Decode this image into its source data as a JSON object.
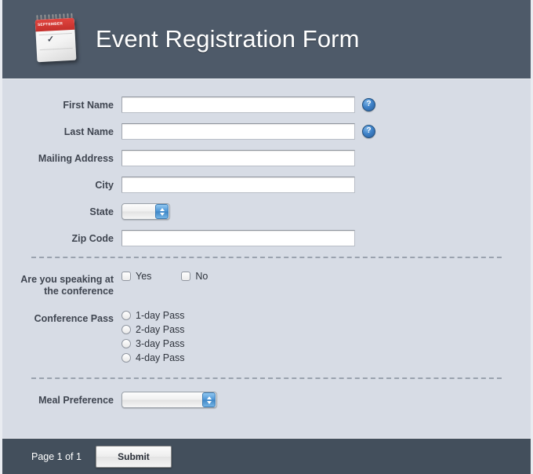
{
  "header": {
    "title": "Event Registration Form",
    "icon": "calendar-icon",
    "calendar_month": "SEPTEMBER"
  },
  "form": {
    "fields": [
      {
        "label": "First Name",
        "type": "text",
        "value": "",
        "placeholder": "",
        "help": "?"
      },
      {
        "label": "Last Name",
        "type": "text",
        "value": "",
        "placeholder": "",
        "help": "?"
      },
      {
        "label": "Mailing Address",
        "type": "text",
        "value": "",
        "placeholder": ""
      },
      {
        "label": "City",
        "type": "text",
        "value": "",
        "placeholder": ""
      },
      {
        "label": "State",
        "type": "select",
        "value": ""
      },
      {
        "label": "Zip Code",
        "type": "text",
        "value": "",
        "placeholder": ""
      }
    ],
    "speaking": {
      "label_line1": "Are you speaking at",
      "label_line2": "the conference",
      "options": [
        {
          "label": "Yes",
          "checked": false
        },
        {
          "label": "No",
          "checked": false
        }
      ]
    },
    "conference_pass": {
      "label": "Conference Pass",
      "options": [
        {
          "label": "1-day Pass",
          "selected": false
        },
        {
          "label": "2-day Pass",
          "selected": false
        },
        {
          "label": "3-day Pass",
          "selected": false
        },
        {
          "label": "4-day Pass",
          "selected": false
        }
      ]
    },
    "meal_preference": {
      "label": "Meal Preference",
      "value": ""
    }
  },
  "footer": {
    "page_indicator": "Page 1 of 1",
    "submit_label": "Submit"
  },
  "colors": {
    "header_bg": "#4e5a69",
    "body_bg": "#d7dce5",
    "footer_bg": "#434f5c",
    "help_icon": "#3f82c8",
    "stepper": "#4f97d6"
  }
}
